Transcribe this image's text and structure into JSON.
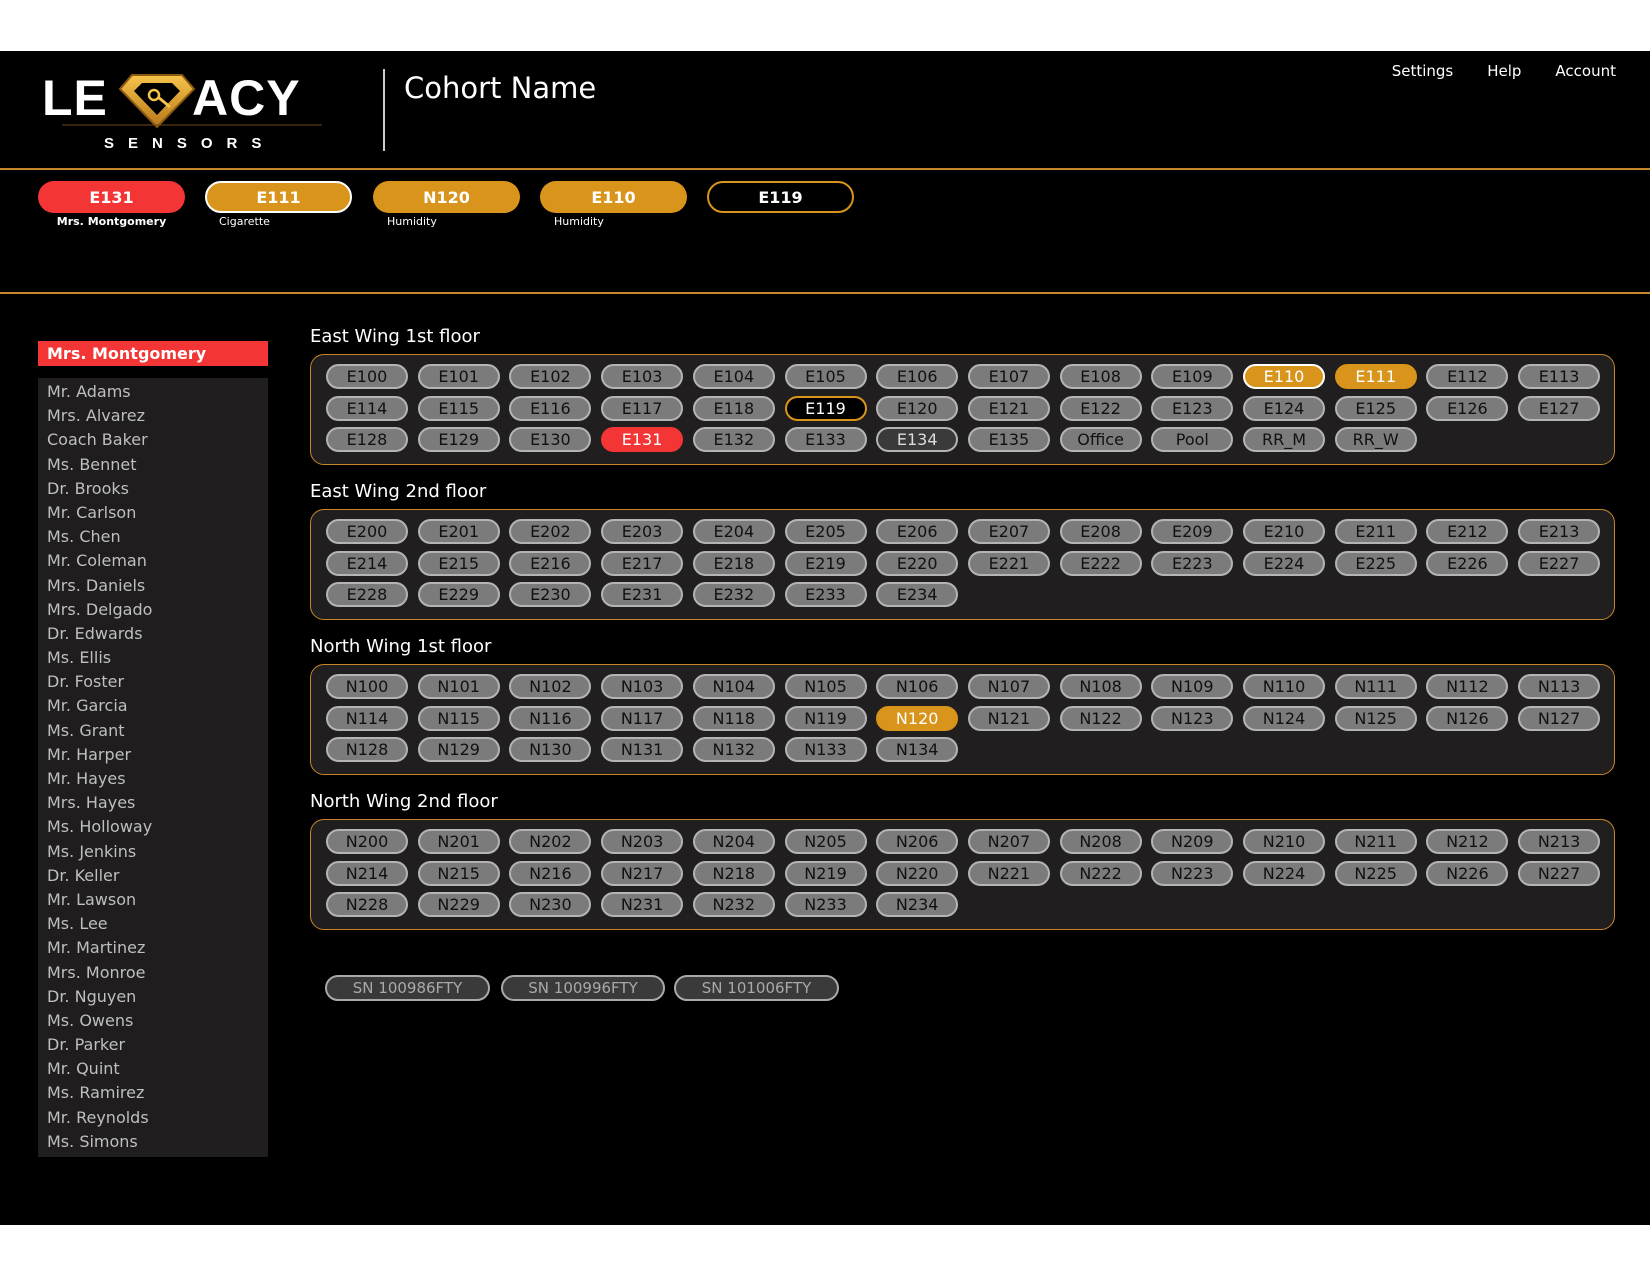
{
  "brand": {
    "name": "LEGACY",
    "sub": "SENSORS",
    "gold": "#d8941b"
  },
  "header": {
    "cohort_name": "Cohort Name"
  },
  "topnav": [
    "Settings",
    "Help",
    "Account"
  ],
  "alerts": [
    {
      "label": "E131",
      "sub": "Mrs. Montgomery",
      "style": "red"
    },
    {
      "label": "E111",
      "sub": "Cigarette",
      "style": "orange-outline"
    },
    {
      "label": "N120",
      "sub": "Humidity",
      "style": "orange"
    },
    {
      "label": "E110",
      "sub": "Humidity",
      "style": "orange"
    },
    {
      "label": "E119",
      "sub": "",
      "style": "black"
    }
  ],
  "sidebar": {
    "selected": "Mrs. Montgomery",
    "people": [
      "Mr. Adams",
      "Mrs. Alvarez",
      "Coach Baker",
      "Ms. Bennet",
      "Dr. Brooks",
      "Mr. Carlson",
      "Ms. Chen",
      "Mr. Coleman",
      "Mrs. Daniels",
      "Mrs. Delgado",
      "Dr. Edwards",
      "Ms. Ellis",
      "Dr. Foster",
      "Mr. Garcia",
      "Ms. Grant",
      "Mr. Harper",
      "Mr. Hayes",
      "Mrs. Hayes",
      "Ms. Holloway",
      "Ms. Jenkins",
      "Dr. Keller",
      "Mr. Lawson",
      "Ms. Lee",
      "Mr. Martinez",
      "Mrs. Monroe",
      "Dr. Nguyen",
      "Ms. Owens",
      "Dr. Parker",
      "Mr. Quint",
      "Ms. Ramirez",
      "Mr. Reynolds",
      "Ms. Simons"
    ]
  },
  "floors": [
    {
      "title": "East Wing 1st floor",
      "rooms": [
        "E100",
        "E101",
        "E102",
        "E103",
        "E104",
        "E105",
        "E106",
        "E107",
        "E108",
        "E109",
        "E110",
        "E111",
        "E112",
        "E113",
        "E114",
        "E115",
        "E116",
        "E117",
        "E118",
        "E119",
        "E120",
        "E121",
        "E122",
        "E123",
        "E124",
        "E125",
        "E126",
        "E127",
        "E128",
        "E129",
        "E130",
        "E131",
        "E132",
        "E133",
        "E134",
        "E135",
        "Office",
        "Pool",
        "RR_M",
        "RR_W"
      ],
      "states": {
        "E110": "alert-orange-outline",
        "E111": "alert-orange",
        "E119": "selected-black",
        "E131": "alert-red",
        "E134": "dark"
      }
    },
    {
      "title": "East Wing 2nd floor",
      "rooms": [
        "E200",
        "E201",
        "E202",
        "E203",
        "E204",
        "E205",
        "E206",
        "E207",
        "E208",
        "E209",
        "E210",
        "E211",
        "E212",
        "E213",
        "E214",
        "E215",
        "E216",
        "E217",
        "E218",
        "E219",
        "E220",
        "E221",
        "E222",
        "E223",
        "E224",
        "E225",
        "E226",
        "E227",
        "E228",
        "E229",
        "E230",
        "E231",
        "E232",
        "E233",
        "E234"
      ],
      "states": {}
    },
    {
      "title": "North Wing 1st floor",
      "rooms": [
        "N100",
        "N101",
        "N102",
        "N103",
        "N104",
        "N105",
        "N106",
        "N107",
        "N108",
        "N109",
        "N110",
        "N111",
        "N112",
        "N113",
        "N114",
        "N115",
        "N116",
        "N117",
        "N118",
        "N119",
        "N120",
        "N121",
        "N122",
        "N123",
        "N124",
        "N125",
        "N126",
        "N127",
        "N128",
        "N129",
        "N130",
        "N131",
        "N132",
        "N133",
        "N134"
      ],
      "states": {
        "N120": "alert-orange"
      }
    },
    {
      "title": "North Wing 2nd floor",
      "rooms": [
        "N200",
        "N201",
        "N202",
        "N203",
        "N204",
        "N205",
        "N206",
        "N207",
        "N208",
        "N209",
        "N210",
        "N211",
        "N212",
        "N213",
        "N214",
        "N215",
        "N216",
        "N217",
        "N218",
        "N219",
        "N220",
        "N221",
        "N222",
        "N223",
        "N224",
        "N225",
        "N226",
        "N227",
        "N228",
        "N229",
        "N230",
        "N231",
        "N232",
        "N233",
        "N234"
      ],
      "states": {}
    }
  ],
  "serials": [
    "SN 100986FTY",
    "SN 100996FTY",
    "SN 101006FTY"
  ]
}
